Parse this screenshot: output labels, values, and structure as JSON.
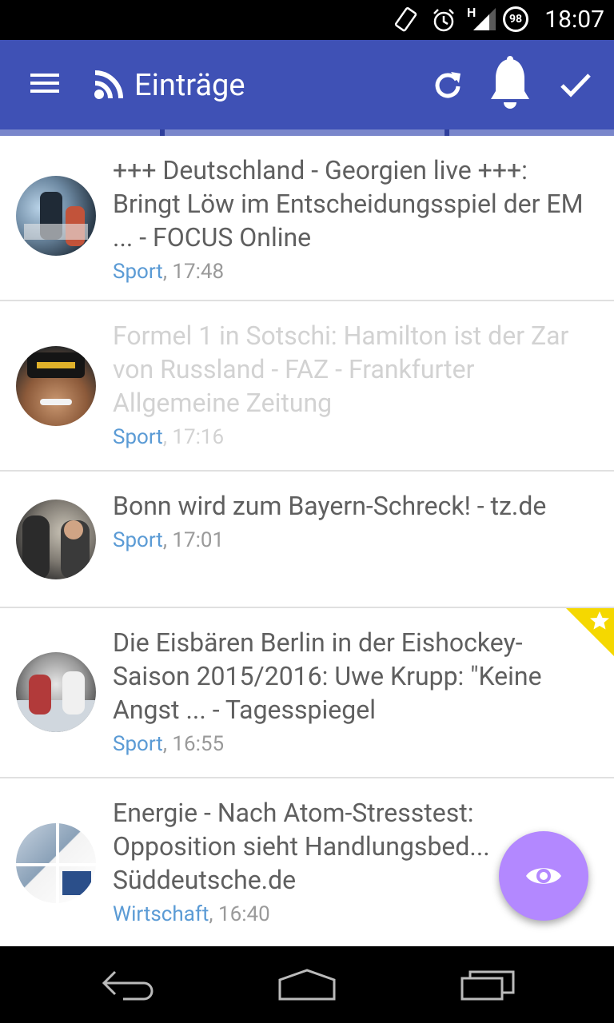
{
  "status_bar": {
    "time": "18:07",
    "battery_level": "98",
    "network_type": "H",
    "icons": [
      "rotate-icon",
      "alarm-icon",
      "signal-icon",
      "battery-icon"
    ]
  },
  "app_bar": {
    "title": "Einträge",
    "icons": [
      "menu-icon",
      "rss-icon",
      "refresh-icon",
      "notification-bell-icon",
      "mark-read-check-icon"
    ],
    "color": "#3f51b5"
  },
  "entries": [
    {
      "title": "+++ Deutschland - Georgien live +++: Bringt Löw im Entscheidungsspiel der EM ... - FOCUS Online",
      "category": "Sport",
      "separator": ", ",
      "time": "17:48",
      "read": false,
      "starred": false
    },
    {
      "title": "Formel 1 in Sotschi: Hamilton ist der Zar von Russland - FAZ - Frankfurter Allgemeine Zeitung",
      "category": "Sport",
      "separator": ", ",
      "time": "17:16",
      "read": true,
      "starred": false
    },
    {
      "title": "Bonn wird zum Bayern-Schreck! - tz.de",
      "category": "Sport",
      "separator": ", ",
      "time": "17:01",
      "read": false,
      "starred": false
    },
    {
      "title": "Die Eisbären Berlin in der Eishockey-Saison 2015/2016: Uwe Krupp: \"Keine Angst ... - Tagesspiegel",
      "category": "Sport",
      "separator": ", ",
      "time": "16:55",
      "read": false,
      "starred": true
    },
    {
      "title": "Energie - Nach Atom-Stresstest: Opposition sieht Handlungsbed... Süddeutsche.de",
      "category": "Wirtschaft",
      "separator": ", ",
      "time": "16:40",
      "read": false,
      "starred": false
    }
  ],
  "fab": {
    "icon": "eye-icon",
    "color": "#b388ff"
  },
  "nav_bar": {
    "icons": [
      "back-icon",
      "home-icon",
      "recents-icon"
    ]
  },
  "colors": {
    "category": "#5b9bd5",
    "title_text": "#5f5f5f",
    "read_text": "#d2d2d2",
    "star_flag": "#f5d800"
  }
}
